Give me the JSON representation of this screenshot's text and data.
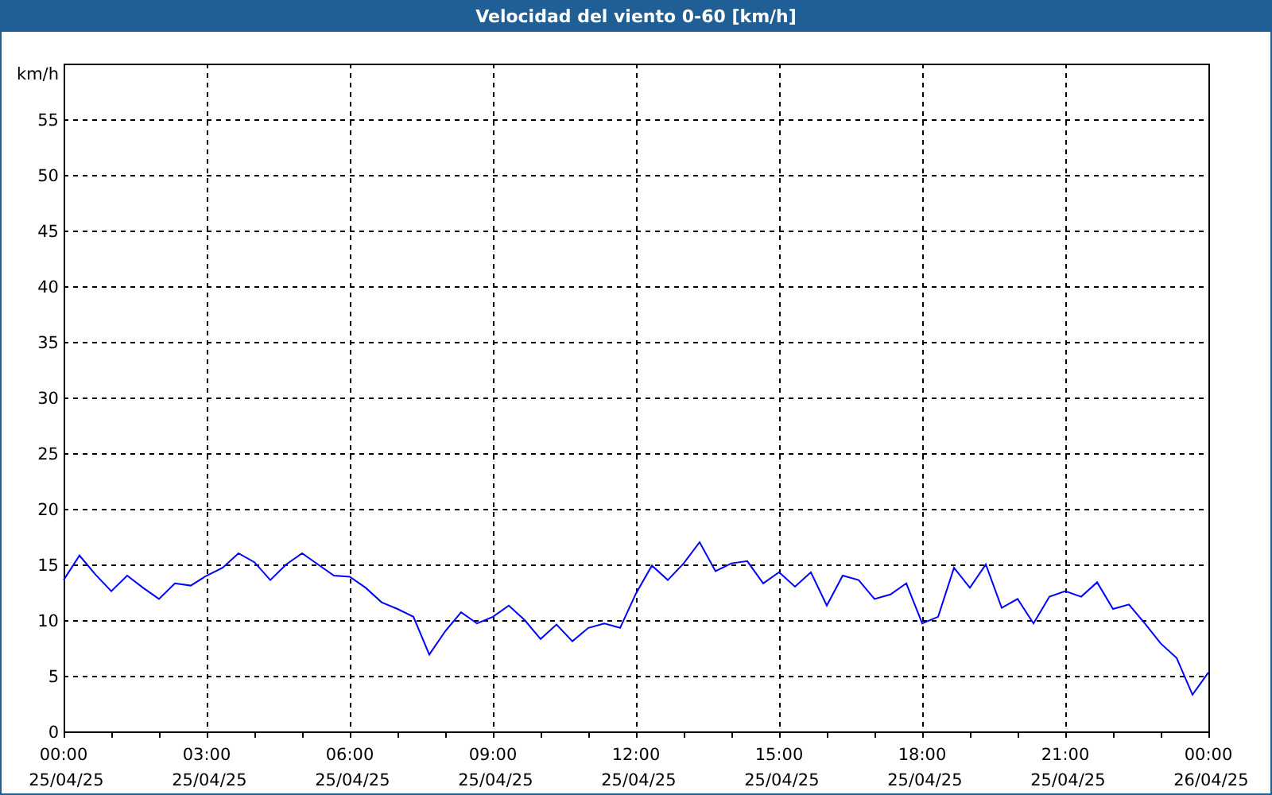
{
  "window": {
    "title": "Velocidad del viento 0-60 [km/h]"
  },
  "chart": {
    "chart_data": {
      "type": "line",
      "grid": true,
      "ylabel": "km/h",
      "ylim": [
        0,
        60
      ],
      "yticks": [
        0,
        5,
        10,
        15,
        20,
        25,
        30,
        35,
        40,
        45,
        50,
        55
      ],
      "categories": [
        "00:00 25/04/25",
        null,
        null,
        null,
        null,
        null,
        null,
        null,
        null,
        "03:00 25/04/25",
        null,
        null,
        null,
        null,
        null,
        null,
        null,
        null,
        "06:00 25/04/25",
        null,
        null,
        null,
        null,
        null,
        null,
        null,
        null,
        "09:00 25/04/25",
        null,
        null,
        null,
        null,
        null,
        null,
        null,
        null,
        "12:00 25/04/25",
        null,
        null,
        null,
        null,
        null,
        null,
        null,
        null,
        "15:00 25/04/25",
        null,
        null,
        null,
        null,
        null,
        null,
        null,
        null,
        "18:00 25/04/25",
        null,
        null,
        null,
        null,
        null,
        null,
        null,
        null,
        "21:00 25/04/25",
        null,
        null,
        null,
        null,
        null,
        null,
        null,
        null,
        "00:00 26/04/25"
      ],
      "series": [
        {
          "color": "#0000ff",
          "values": [
            13.6,
            15.8,
            14.1,
            12.6,
            14,
            12.9,
            11.9,
            13.3,
            13.1,
            14,
            14.7,
            16,
            15.2,
            13.6,
            15,
            16,
            15,
            14,
            13.9,
            12.9,
            11.6,
            11,
            10.3,
            6.9,
            9,
            10.7,
            9.7,
            10.3,
            11.3,
            10,
            8.3,
            9.6,
            8.1,
            9.3,
            9.7,
            9.3,
            12.4,
            14.9,
            13.6,
            15.1,
            17,
            14.4,
            15.1,
            15.3,
            13.3,
            14.3,
            13,
            14.3,
            11.3,
            14,
            13.6,
            11.9,
            12.3,
            13.3,
            9.7,
            10.3,
            14.7,
            12.9,
            15,
            11.1,
            11.9,
            9.7,
            12.1,
            12.6,
            12.1,
            13.4,
            11,
            11.4,
            9.7,
            7.9,
            6.6,
            3.3,
            5.3
          ]
        }
      ]
    }
  }
}
